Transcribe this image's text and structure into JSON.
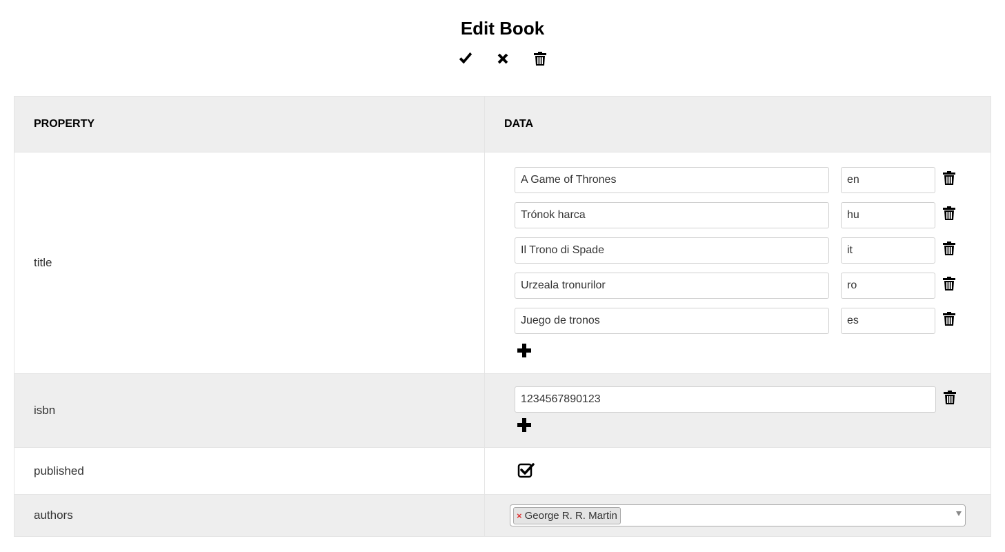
{
  "page": {
    "title": "Edit Book"
  },
  "toolbar": {
    "save_icon": "check-icon",
    "cancel_icon": "close-icon",
    "delete_icon": "trash-icon"
  },
  "table": {
    "headers": {
      "property": "PROPERTY",
      "data": "DATA"
    },
    "title": {
      "label": "title",
      "entries": [
        {
          "value": "A Game of Thrones",
          "lang": "en"
        },
        {
          "value": "Trónok harca",
          "lang": "hu"
        },
        {
          "value": "Il Trono di Spade",
          "lang": "it"
        },
        {
          "value": "Urzeala tronurilor",
          "lang": "ro"
        },
        {
          "value": "Juego de tronos",
          "lang": "es"
        }
      ]
    },
    "isbn": {
      "label": "isbn",
      "entries": [
        {
          "value": "1234567890123"
        }
      ]
    },
    "published": {
      "label": "published",
      "checked": true
    },
    "authors": {
      "label": "authors",
      "selected": [
        "George R. R. Martin"
      ],
      "remove_symbol": "×"
    }
  }
}
